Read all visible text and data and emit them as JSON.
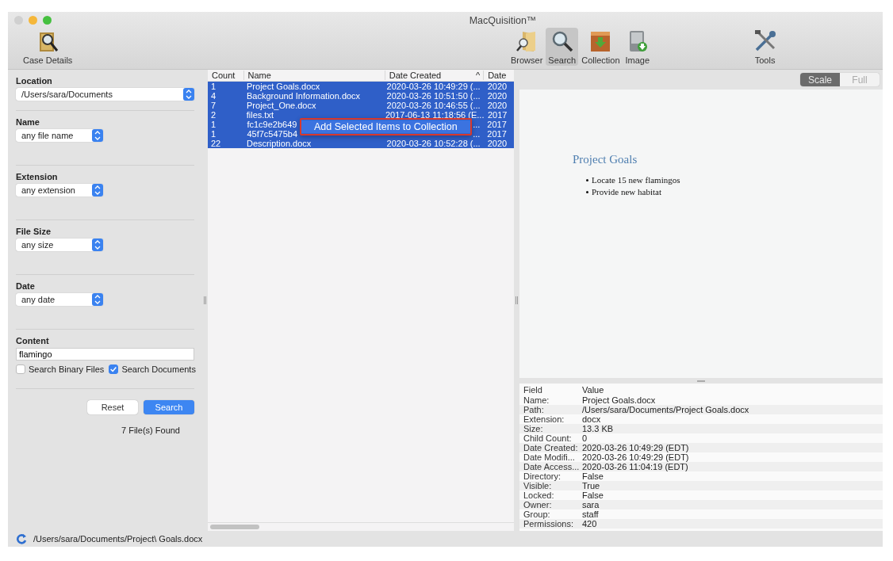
{
  "window": {
    "title": "MacQuisition™"
  },
  "toolbar": {
    "left": [
      {
        "label": "Case Details",
        "selected": false
      }
    ],
    "center": [
      {
        "label": "Browser",
        "selected": false
      },
      {
        "label": "Search",
        "selected": true
      },
      {
        "label": "Collection",
        "selected": false
      },
      {
        "label": "Image",
        "selected": false
      }
    ],
    "right": [
      {
        "label": "Tools",
        "selected": false
      }
    ]
  },
  "search_panel": {
    "sections": [
      {
        "kind": "select",
        "label": "Location",
        "value": "/Users/sara/Documents"
      },
      {
        "kind": "select",
        "label": "Name",
        "value": "any file name"
      },
      {
        "kind": "select",
        "label": "Extension",
        "value": "any extension"
      },
      {
        "kind": "select",
        "label": "File Size",
        "value": "any size"
      },
      {
        "kind": "select",
        "label": "Date",
        "value": "any date"
      },
      {
        "kind": "content",
        "label": "Content",
        "value": "flamingo",
        "options": [
          {
            "label": "Search Binary Files",
            "checked": false
          },
          {
            "label": "Search Documents",
            "checked": true
          }
        ]
      }
    ],
    "buttons": [
      {
        "label": "Reset",
        "primary": false
      },
      {
        "label": "Search",
        "primary": true
      }
    ],
    "result": "7 File(s) Found"
  },
  "results_table": {
    "columns": [
      {
        "label": "Count"
      },
      {
        "label": "Name"
      },
      {
        "label": "Date Created",
        "sort": "^"
      },
      {
        "label": "Date"
      }
    ],
    "rows": [
      {
        "selected": true,
        "cells": [
          "1",
          "Project Goals.docx",
          "2020-03-26 10:49:29 (...",
          "2020"
        ]
      },
      {
        "selected": true,
        "cells": [
          "4",
          "Background Information.docx",
          "2020-03-26 10:51:50 (...",
          "2020"
        ]
      },
      {
        "selected": true,
        "cells": [
          "7",
          "Project_One.docx",
          "2020-03-26 10:46:55 (...",
          "2020"
        ]
      },
      {
        "selected": true,
        "cells": [
          "2",
          "files.txt",
          "2017-06-13 11:18:56 (E...",
          "2017"
        ]
      },
      {
        "selected": true,
        "cells": [
          "1",
          "fc1c9e2b649",
          "...",
          "2017"
        ]
      },
      {
        "selected": true,
        "cells": [
          "1",
          "45f7c5475b4",
          "...",
          "2017"
        ]
      },
      {
        "selected": true,
        "cells": [
          "22",
          "Description.docx",
          "2020-03-26 10:52:28 (...",
          "2020"
        ]
      }
    ],
    "context_menu": {
      "items": [
        {
          "label": "Add Selected Items to Collection",
          "highlighted": true
        }
      ]
    }
  },
  "preview": {
    "modes": [
      {
        "label": "Scale",
        "selected": true
      },
      {
        "label": "Full",
        "selected": false
      }
    ],
    "document": {
      "title": "Project Goals",
      "bullets": [
        "Locate 15 new flamingos",
        "Provide new habitat"
      ]
    }
  },
  "properties": {
    "columns": [
      "Field",
      "Value"
    ],
    "rows": [
      [
        "Name:",
        "Project Goals.docx"
      ],
      [
        "Path:",
        "/Users/sara/Documents/Project Goals.docx"
      ],
      [
        "Extension:",
        "docx"
      ],
      [
        "Size:",
        "13.3 KB"
      ],
      [
        "Child Count:",
        "0"
      ],
      [
        "Date Created:",
        "2020-03-26 10:49:29 (EDT)"
      ],
      [
        "Date Modifi...",
        "2020-03-26 10:49:29 (EDT)"
      ],
      [
        "Date Access...",
        "2020-03-26 11:04:19 (EDT)"
      ],
      [
        "Directory:",
        "False"
      ],
      [
        "Visible:",
        "True"
      ],
      [
        "Locked:",
        "False"
      ],
      [
        "Owner:",
        "sara"
      ],
      [
        "Group:",
        "staff"
      ],
      [
        "Permissions:",
        "420"
      ]
    ]
  },
  "status_bar": {
    "path": "/Users/sara/Documents/Project\\ Goals.docx"
  }
}
